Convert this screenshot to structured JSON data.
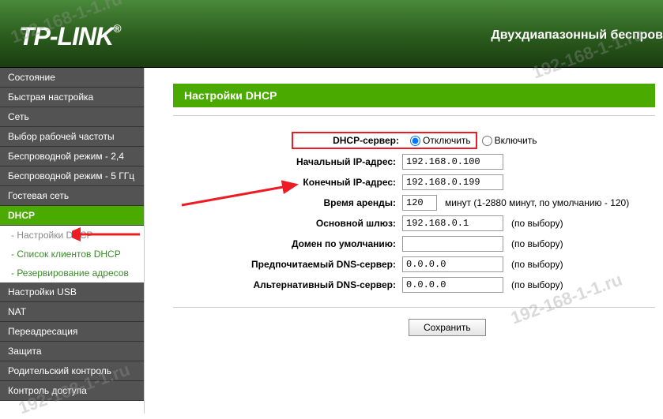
{
  "header": {
    "brand": "TP-LINK",
    "reg": "®",
    "title": "Двухдиапазонный беспров"
  },
  "sidebar": {
    "items": [
      {
        "label": "Состояние"
      },
      {
        "label": "Быстрая настройка"
      },
      {
        "label": "Сеть"
      },
      {
        "label": "Выбор рабочей частоты"
      },
      {
        "label": "Беспроводной режим - 2,4"
      },
      {
        "label": "Беспроводной режим - 5 ГГц"
      },
      {
        "label": "Гостевая сеть"
      },
      {
        "label": "DHCP"
      },
      {
        "label": "Настройки USB"
      },
      {
        "label": "NAT"
      },
      {
        "label": "Переадресация"
      },
      {
        "label": "Защита"
      },
      {
        "label": "Родительский контроль"
      },
      {
        "label": "Контроль доступа"
      }
    ],
    "subs": [
      {
        "label": "- Настройки DHCP"
      },
      {
        "label": "- Список клиентов DHCP"
      },
      {
        "label": "- Резервирование адресов"
      }
    ]
  },
  "page": {
    "title": "Настройки DHCP",
    "rows": {
      "server_label": "DHCP-сервер:",
      "disable": "Отключить",
      "enable": "Включить",
      "start_label": "Начальный IP-адрес:",
      "start_val": "192.168.0.100",
      "end_label": "Конечный IP-адрес:",
      "end_val": "192.168.0.199",
      "lease_label": "Время аренды:",
      "lease_val": "120",
      "lease_note": "минут (1-2880 минут, по умолчанию - 120)",
      "gateway_label": "Основной шлюз:",
      "gateway_val": "192.168.0.1",
      "optional": "(по выбору)",
      "domain_label": "Домен по умолчанию:",
      "domain_val": "",
      "dns1_label": "Предпочитаемый DNS-сервер:",
      "dns1_val": "0.0.0.0",
      "dns2_label": "Альтернативный DNS-сервер:",
      "dns2_val": "0.0.0.0"
    },
    "save": "Сохранить"
  },
  "watermark": "192-168-1-1.ru"
}
